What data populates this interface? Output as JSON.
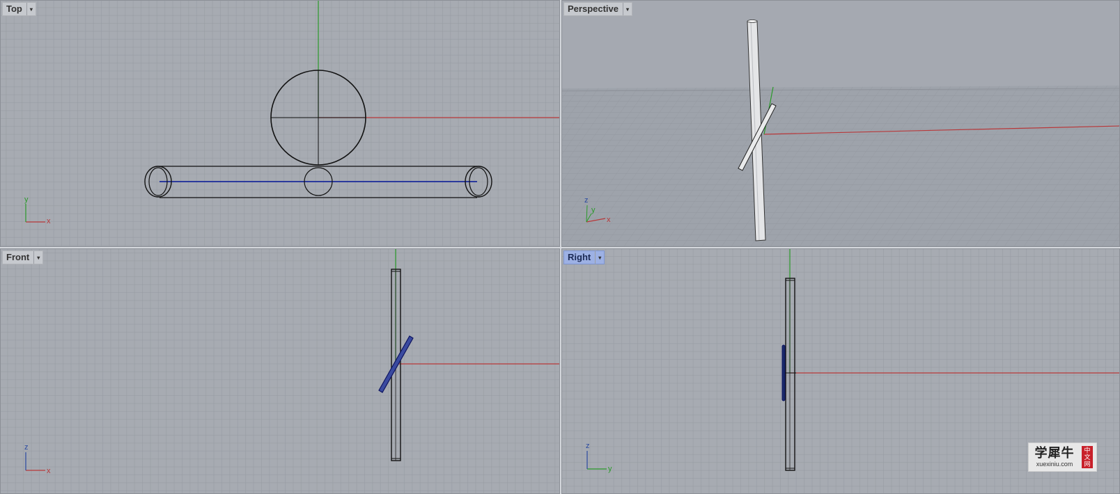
{
  "viewports": {
    "top": {
      "label": "Top",
      "axis_x": "x",
      "axis_y": "y",
      "active": false
    },
    "persp": {
      "label": "Perspective",
      "axis_x": "x",
      "axis_y": "y",
      "axis_z": "z",
      "active": false
    },
    "front": {
      "label": "Front",
      "axis_x": "x",
      "axis_y": "z",
      "active": false
    },
    "right": {
      "label": "Right",
      "axis_x": "y",
      "axis_y": "z",
      "active": true
    }
  },
  "dropdown_glyph": "▾",
  "watermark": {
    "chinese": "学犀牛",
    "url": "xuexiniu.com",
    "badge": [
      "中",
      "文",
      "网"
    ]
  },
  "colors": {
    "viewport_bg": "#a7abb2",
    "x_axis": "#b8383a",
    "y_axis": "#2a9a2a",
    "selected_curve": "#1a2a9a",
    "active_label_bg": "#9db1e4"
  }
}
